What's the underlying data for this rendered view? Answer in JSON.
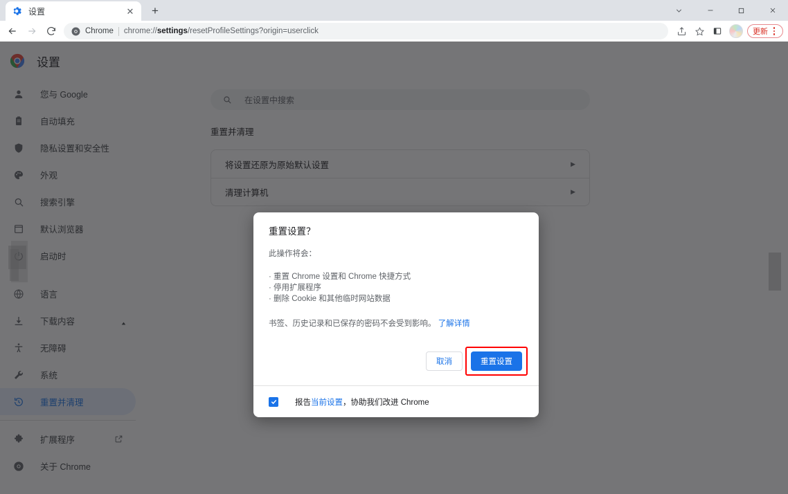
{
  "window": {
    "controls": [
      {
        "name": "chevron-down",
        "glyph": "⌄"
      },
      {
        "name": "minimize",
        "glyph": "─"
      },
      {
        "name": "maximize",
        "glyph": "□"
      },
      {
        "name": "close",
        "glyph": "✕"
      }
    ]
  },
  "tab": {
    "title": "设置",
    "favicon": "gear-icon",
    "close_glyph": "✕",
    "newtab_glyph": "+"
  },
  "toolbar": {
    "back_glyph": "←",
    "forward_glyph": "→",
    "reload_glyph": "↻",
    "omnibox": {
      "site_icon": "chrome-icon",
      "site_label": "Chrome",
      "url_prefix": "chrome://",
      "url_bold": "settings",
      "url_suffix": "/resetProfileSettings?origin=userclick",
      "full_url": "chrome://settings/resetProfileSettings?origin=userclick"
    },
    "share_icon": "share-icon",
    "bookmark_icon": "star-icon",
    "side_panel_icon": "side-panel-icon",
    "avatar": "profile-avatar",
    "update_label": "更新",
    "menu_icon": "kebab-menu-icon"
  },
  "settings": {
    "brand_title": "设置",
    "search_placeholder": "在设置中搜索",
    "sidebar": [
      {
        "label": "您与 Google",
        "icon": "person-icon",
        "selected": false
      },
      {
        "label": "自动填充",
        "icon": "clipboard-icon",
        "selected": false
      },
      {
        "label": "隐私设置和安全性",
        "icon": "shield-icon",
        "selected": false
      },
      {
        "label": "外观",
        "icon": "palette-icon",
        "selected": false
      },
      {
        "label": "搜索引擎",
        "icon": "search-icon",
        "selected": false
      },
      {
        "label": "默认浏览器",
        "icon": "browser-icon",
        "selected": false
      },
      {
        "label": "启动时",
        "icon": "power-icon",
        "selected": false
      },
      {
        "label": "语言",
        "icon": "globe-icon",
        "selected": false
      },
      {
        "label": "下载内容",
        "icon": "download-icon",
        "selected": false
      },
      {
        "label": "无障碍",
        "icon": "accessibility-icon",
        "selected": false
      },
      {
        "label": "系统",
        "icon": "wrench-icon",
        "selected": false
      },
      {
        "label": "重置并清理",
        "icon": "restore-icon",
        "selected": true
      }
    ],
    "sidebar_footer": [
      {
        "label": "扩展程序",
        "icon": "puzzle-icon",
        "external": true
      },
      {
        "label": "关于 Chrome",
        "icon": "chrome-icon",
        "external": false
      }
    ],
    "section_title": "重置并清理",
    "rows": [
      {
        "label": "将设置还原为原始默认设置",
        "arrow": "▶"
      },
      {
        "label": "清理计算机",
        "arrow": "▶"
      }
    ]
  },
  "dialog": {
    "title": "重置设置？",
    "subtitle": "此操作将会：",
    "bullets": [
      "· 重置 Chrome 设置和 Chrome 快捷方式",
      "· 停用扩展程序",
      "· 删除 Cookie 和其他临时网站数据"
    ],
    "note_text": "书签、历史记录和已保存的密码不会受到影响。",
    "note_link": "了解详情",
    "cancel_label": "取消",
    "confirm_label": "重置设置",
    "checkbox_checked": true,
    "checkbox_prefix": "报告",
    "checkbox_link": "当前设置",
    "checkbox_suffix": "，协助我们改进 Chrome"
  },
  "colors": {
    "accent_blue": "#1a73e8",
    "highlight_red": "#ff0000",
    "update_red": "#d93025",
    "scrim": "rgba(32,33,36,0.62)"
  }
}
